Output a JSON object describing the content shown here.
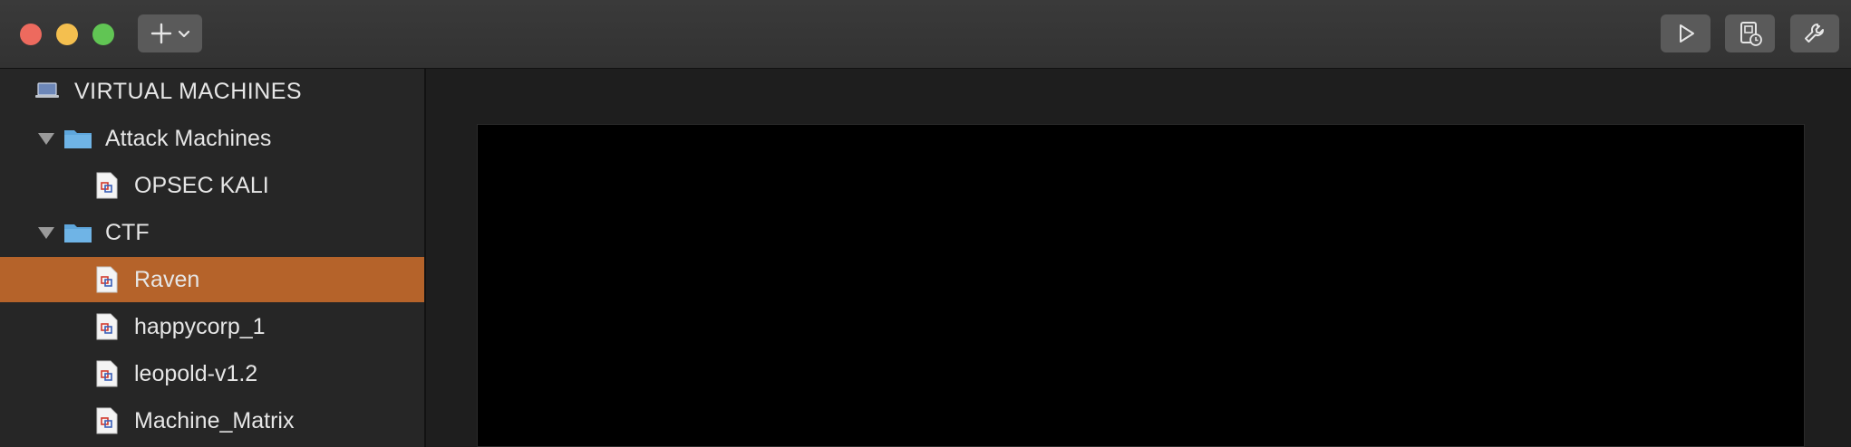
{
  "window": {
    "controls": [
      "close",
      "minimize",
      "zoom"
    ]
  },
  "toolbar": {
    "add_icon": "plus-icon",
    "add_menu_icon": "chevron-down-icon",
    "play_icon": "play-icon",
    "vm_settings_icon": "vm-snapshot-icon",
    "tools_icon": "wrench-icon"
  },
  "sidebar": {
    "header": {
      "label": "VIRTUAL MACHINES",
      "icon": "laptop-icon"
    },
    "groups": [
      {
        "label": "Attack Machines",
        "expanded": true,
        "icon": "folder-icon",
        "items": [
          {
            "label": "OPSEC KALI",
            "icon": "vm-file-icon"
          }
        ]
      },
      {
        "label": "CTF",
        "expanded": true,
        "icon": "folder-icon",
        "items": [
          {
            "label": "Raven",
            "icon": "vm-file-icon",
            "selected": true
          },
          {
            "label": "happycorp_1",
            "icon": "vm-file-icon"
          },
          {
            "label": "leopold-v1.2",
            "icon": "vm-file-icon"
          },
          {
            "label": "Machine_Matrix",
            "icon": "vm-file-icon"
          }
        ]
      }
    ]
  },
  "colors": {
    "selection": "#b5632a",
    "sidebar_bg": "#262626",
    "toolbar_bg": "#323232",
    "screen_bg": "#000000"
  }
}
